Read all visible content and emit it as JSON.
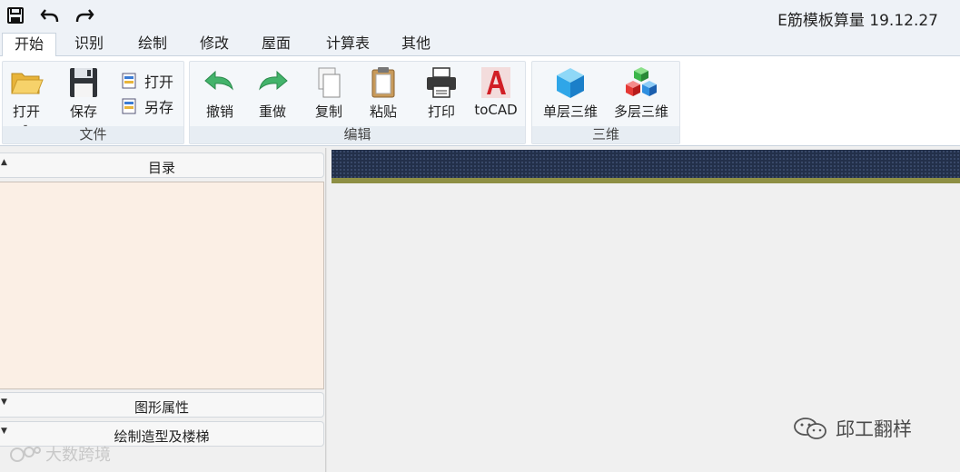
{
  "app": {
    "title": "E筋模板算量 19.12.27"
  },
  "quick_access": {
    "save_icon": "save-icon",
    "undo_icon": "undo-icon",
    "redo_icon": "redo-icon"
  },
  "tabs": [
    {
      "label": "开始",
      "active": true
    },
    {
      "label": "识别"
    },
    {
      "label": "绘制"
    },
    {
      "label": "修改"
    },
    {
      "label": "屋面"
    },
    {
      "label": "计算表"
    },
    {
      "label": "其他"
    }
  ],
  "ribbon": {
    "file_group": {
      "label": "文件",
      "open_label": "打开",
      "save_label": "保存",
      "small_open_label": "打开",
      "save_as_label": "另存"
    },
    "edit_group": {
      "label": "编辑",
      "undo_label": "撤销",
      "redo_label": "重做",
      "copy_label": "复制",
      "paste_label": "粘贴",
      "print_label": "打印",
      "tocad_label": "toCAD"
    },
    "view3d_group": {
      "label": "三维",
      "single_floor_label": "单层三维",
      "multi_floor_label": "多层三维"
    }
  },
  "panel": {
    "catalog_label": "目录",
    "shape_props_label": "图形属性",
    "draw_shapes_label": "绘制造型及楼梯"
  },
  "watermarks": {
    "wechat": "邱工翻样",
    "corner": "大数跨境"
  },
  "colors": {
    "canvas_strip": "#23304a",
    "canvas_line": "#8e8f44",
    "catalog_bg": "#fbefe5",
    "ribbon_bg": "#f4f7fa"
  }
}
